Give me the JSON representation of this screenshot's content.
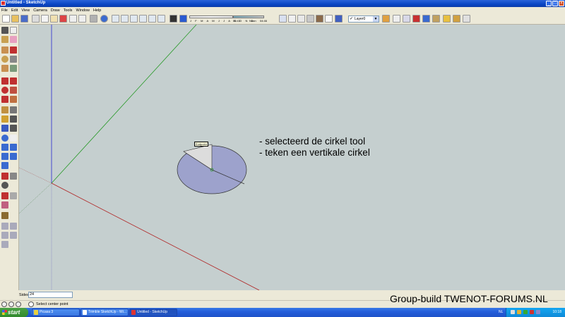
{
  "window": {
    "title": "Untitled - SketchUp"
  },
  "menu": [
    "File",
    "Edit",
    "View",
    "Camera",
    "Draw",
    "Tools",
    "Window",
    "Help"
  ],
  "shadow": {
    "months": "J F M A M J J A S O N D",
    "time_start": "06:43",
    "time_mid": "Noon",
    "time_end": "04:46"
  },
  "layer": {
    "selected": "Layer0"
  },
  "tooltip": "Endpoint",
  "annotation": [
    "- selecteerd de cirkel tool",
    "- teken een vertikale cirkel"
  ],
  "vcb": {
    "label": "Sides",
    "value": "24"
  },
  "status": {
    "text": "Select center point"
  },
  "watermark": "Group-build TWENOT-FORUMS.NL",
  "taskbar": {
    "start_label": "start",
    "buttons": [
      {
        "label": "Picasa 3"
      },
      {
        "label": "Trimble SketchUp - Wi..."
      },
      {
        "label": "Untitled - SketchUp"
      }
    ],
    "language": "NL",
    "clock": "10:18"
  },
  "colors": {
    "axis_blue": "#3a3ad0",
    "axis_green": "#2a9a2a",
    "axis_red": "#b02020",
    "circle_fill": "#9da2cc",
    "viewport_bg": "#c5cfcf"
  }
}
